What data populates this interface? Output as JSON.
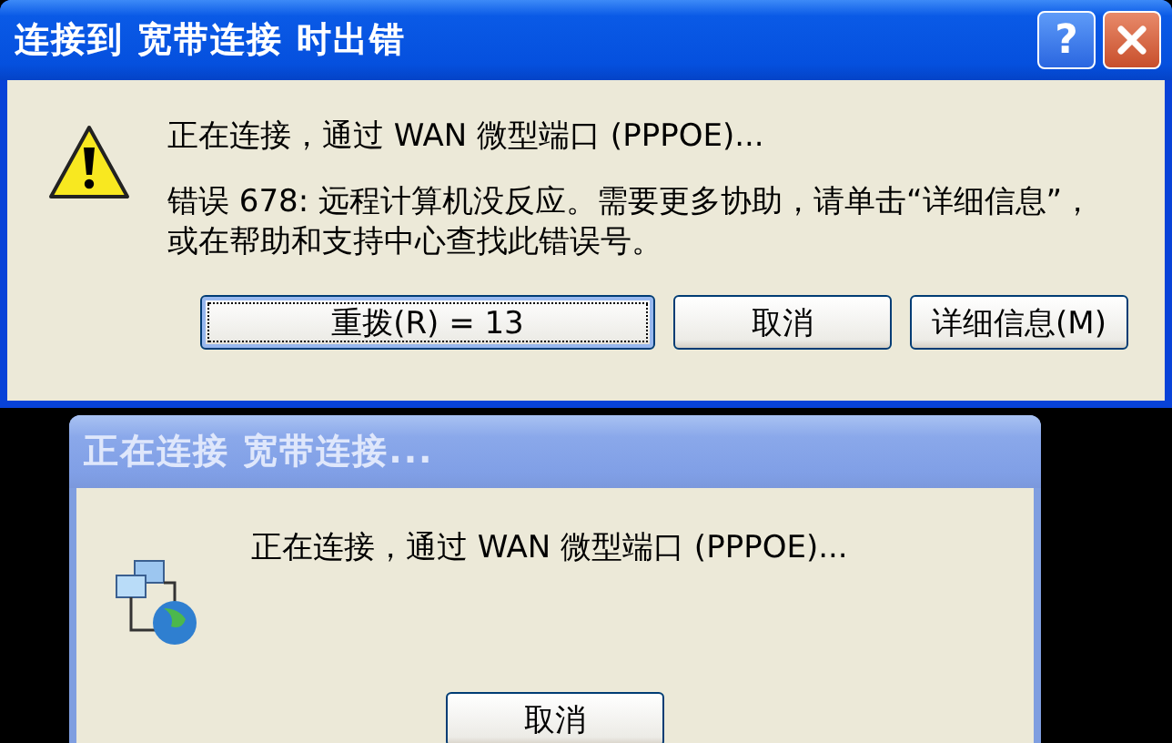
{
  "dialogs": [
    {
      "title": "连接到 宽带连接 时出错",
      "active": true,
      "kind": "error",
      "help_button": "?",
      "messages": [
        "正在连接，通过 WAN 微型端口 (PPPOE)...",
        "错误 678: 远程计算机没反应。需要更多协助，请单击“详细信息”，或在帮助和支持中心查找此错误号。"
      ],
      "buttons": [
        {
          "label": "重拨(R) = 13",
          "default": true
        },
        {
          "label": "取消",
          "default": false
        },
        {
          "label": "详细信息(M)",
          "default": false
        }
      ]
    },
    {
      "title": "正在连接 宽带连接...",
      "active": false,
      "kind": "progress",
      "messages": [
        "正在连接，通过 WAN 微型端口 (PPPOE)..."
      ],
      "buttons": [
        {
          "label": "取消",
          "default": false
        }
      ]
    }
  ]
}
